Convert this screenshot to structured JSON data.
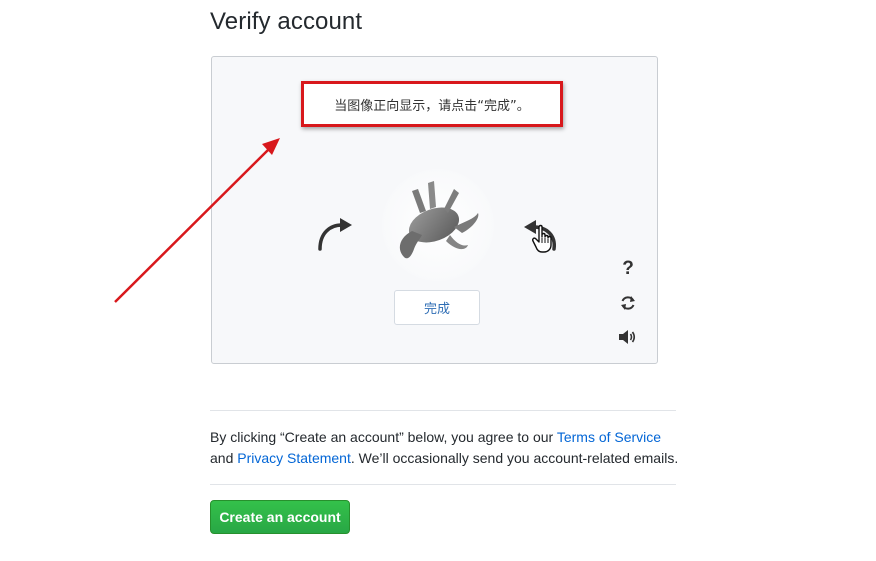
{
  "page": {
    "title": "Verify account"
  },
  "captcha": {
    "instruction": "当图像正向显示，请点击“完成”。",
    "done_label": "完成",
    "help_symbol": "?",
    "icons": {
      "rotate_left": "rotate-left-arrow-icon",
      "rotate_right": "rotate-right-arrow-icon",
      "help": "question-mark-icon",
      "refresh": "refresh-icon",
      "audio": "speaker-icon"
    },
    "image": "upside-down-animal-figurine"
  },
  "terms": {
    "prefix": "By clicking “Create an account” below, you agree to our",
    "tos_link": "Terms of Service",
    "and": "and",
    "privacy_link": "Privacy Statement",
    "suffix": ". We’ll occasionally send you account-related emails."
  },
  "actions": {
    "create_label": "Create an account"
  },
  "colors": {
    "highlight_box": "#d8181c",
    "annotation_arrow": "#d8181c",
    "link": "#0366d6",
    "primary_button": "#28a745"
  }
}
